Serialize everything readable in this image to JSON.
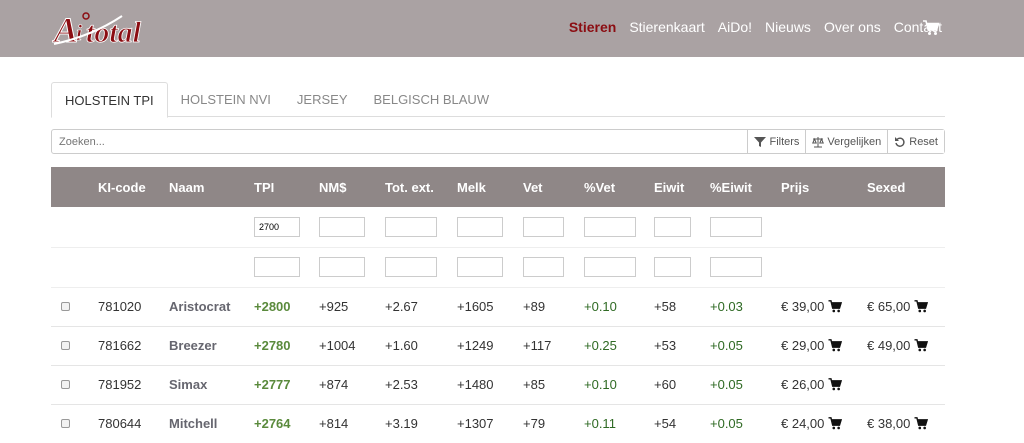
{
  "brand": {
    "logo_text": "AI total",
    "accent": "#8b0d12",
    "navbar_bg": "#aaa2a3"
  },
  "nav": [
    {
      "label": "Stieren",
      "active": true
    },
    {
      "label": "Stierenkaart"
    },
    {
      "label": "AiDo!"
    },
    {
      "label": "Nieuws"
    },
    {
      "label": "Over ons"
    },
    {
      "label": "Contact"
    }
  ],
  "cart_icon": "cart-icon",
  "tabs": [
    "HOLSTEIN TPI",
    "HOLSTEIN NVI",
    "JERSEY",
    "BELGISCH BLAUW"
  ],
  "search": {
    "placeholder": "Zoeken...",
    "filters": "Filters",
    "compare": "Vergelijken",
    "reset": "Reset"
  },
  "table": {
    "headers": [
      "",
      "KI-code",
      "Naam",
      "TPI",
      "NM$",
      "Tot. ext.",
      "Melk",
      "Vet",
      "%Vet",
      "Eiwit",
      "%Eiwit",
      "Prijs",
      "Sexed"
    ],
    "tpi_filter_value": "2700",
    "rows": [
      {
        "code": "781020",
        "name": "Aristocrat",
        "tpi": "+2800",
        "nm": "+925",
        "tot": "+2.67",
        "melk": "+1605",
        "vet": "+89",
        "pvet": "+0.10",
        "eiwit": "+58",
        "peiwit": "+0.03",
        "prijs": "€ 39,00",
        "sexed": "€ 65,00"
      },
      {
        "code": "781662",
        "name": "Breezer",
        "tpi": "+2780",
        "nm": "+1004",
        "tot": "+1.60",
        "melk": "+1249",
        "vet": "+117",
        "pvet": "+0.25",
        "eiwit": "+53",
        "peiwit": "+0.05",
        "prijs": "€ 29,00",
        "sexed": "€ 49,00"
      },
      {
        "code": "781952",
        "name": "Simax",
        "tpi": "+2777",
        "nm": "+874",
        "tot": "+2.53",
        "melk": "+1480",
        "vet": "+85",
        "pvet": "+0.10",
        "eiwit": "+60",
        "peiwit": "+0.05",
        "prijs": "€ 26,00",
        "sexed": ""
      },
      {
        "code": "780644",
        "name": "Mitchell",
        "tpi": "+2764",
        "nm": "+814",
        "tot": "+3.19",
        "melk": "+1307",
        "vet": "+79",
        "pvet": "+0.11",
        "eiwit": "+54",
        "peiwit": "+0.05",
        "prijs": "€ 24,00",
        "sexed": "€ 38,00"
      }
    ]
  }
}
